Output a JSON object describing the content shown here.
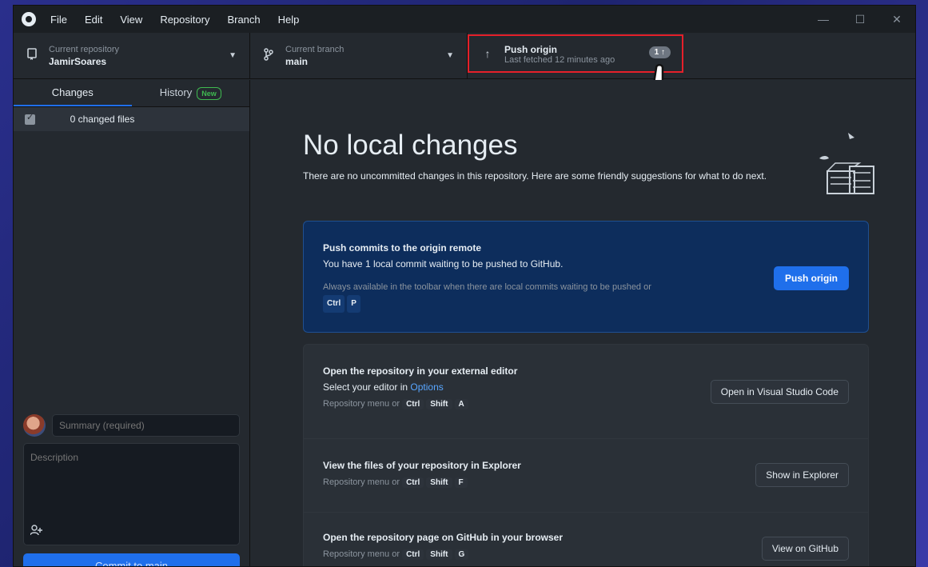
{
  "menu": [
    "File",
    "Edit",
    "View",
    "Repository",
    "Branch",
    "Help"
  ],
  "window_controls": {
    "minimize": "—",
    "maximize": "☐",
    "close": "✕"
  },
  "toolbar": {
    "repo_label": "Current repository",
    "repo_value": "JamirSoares",
    "branch_label": "Current branch",
    "branch_value": "main",
    "push_title": "Push origin",
    "push_sub": "Last fetched 12 minutes ago",
    "push_badge": "1 ↑"
  },
  "sidebar": {
    "tab_changes": "Changes",
    "tab_history": "History",
    "history_badge": "New",
    "changed_files": "0 changed files",
    "summary_placeholder": "Summary (required)",
    "description_placeholder": "Description",
    "commit_button": "Commit to main"
  },
  "main": {
    "heading": "No local changes",
    "subtext": "There are no uncommitted changes in this repository. Here are some friendly suggestions for what to do next.",
    "push_card": {
      "title": "Push commits to the origin remote",
      "desc": "You have 1 local commit waiting to be pushed to GitHub.",
      "hint": "Always available in the toolbar when there are local commits waiting to be pushed or",
      "keys": [
        "Ctrl",
        "P"
      ],
      "button": "Push origin"
    },
    "editor_card": {
      "title": "Open the repository in your external editor",
      "sub_prefix": "Select your editor in ",
      "sub_link": "Options",
      "hint": "Repository menu or",
      "keys": [
        "Ctrl",
        "Shift",
        "A"
      ],
      "button": "Open in Visual Studio Code"
    },
    "explorer_card": {
      "title": "View the files of your repository in Explorer",
      "hint": "Repository menu or",
      "keys": [
        "Ctrl",
        "Shift",
        "F"
      ],
      "button": "Show in Explorer"
    },
    "github_card": {
      "title": "Open the repository page on GitHub in your browser",
      "hint": "Repository menu or",
      "keys": [
        "Ctrl",
        "Shift",
        "G"
      ],
      "button": "View on GitHub"
    }
  },
  "colors": {
    "accent": "#1f6feb",
    "highlight": "#e5202a",
    "link": "#58a6ff"
  }
}
